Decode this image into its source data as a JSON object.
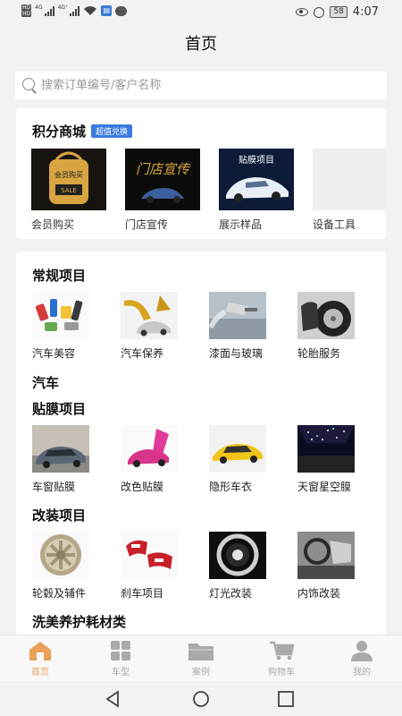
{
  "status": {
    "hd_top": "HD",
    "hd_bottom": "HD",
    "net1": "4G",
    "net2": "4G⁺",
    "battery": "58",
    "time": "4:07"
  },
  "title": "首页",
  "search": {
    "placeholder": "搜索订单编号/客户名称"
  },
  "mall": {
    "heading": "积分商城",
    "badge": "超值兑换",
    "items": [
      {
        "label": "会员购买",
        "image_text": "会员购买"
      },
      {
        "label": "门店宣传",
        "image_text": "门店宣传"
      },
      {
        "label": "展示样品",
        "image_text": "贴膜项目"
      },
      {
        "label": "设备工具"
      }
    ]
  },
  "services": {
    "regular": {
      "heading": "常规项目",
      "items": [
        {
          "label": "汽车美容"
        },
        {
          "label": "汽车保养"
        },
        {
          "label": "漆面与玻璃"
        },
        {
          "label": "轮胎服务"
        }
      ]
    },
    "car_heading": "汽车",
    "film": {
      "heading": "贴膜项目",
      "items": [
        {
          "label": "车窗贴膜"
        },
        {
          "label": "改色贴膜"
        },
        {
          "label": "隐形车衣"
        },
        {
          "label": "天窗星空膜"
        }
      ]
    },
    "mod": {
      "heading": "改装项目",
      "items": [
        {
          "label": "轮毂及辅件"
        },
        {
          "label": "刹车项目"
        },
        {
          "label": "灯光改装"
        },
        {
          "label": "内饰改装"
        }
      ]
    },
    "consumables_heading": "洗美养护耗材类"
  },
  "tabs": [
    {
      "label": "首页",
      "icon": "home-icon",
      "active": true
    },
    {
      "label": "车型",
      "icon": "grid-icon"
    },
    {
      "label": "案例",
      "icon": "folder-icon"
    },
    {
      "label": "购物车",
      "icon": "cart-icon"
    },
    {
      "label": "我的",
      "icon": "user-icon"
    }
  ],
  "colors": {
    "accent": "#e8a05a",
    "badge": "#3c7be0",
    "tab_inactive": "#aaaaaa"
  }
}
